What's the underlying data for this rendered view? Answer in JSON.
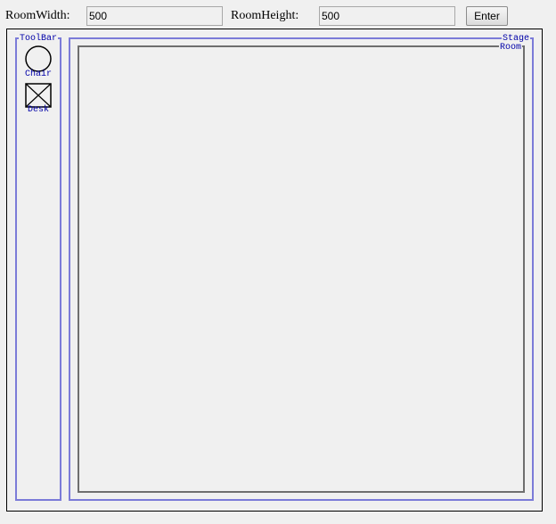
{
  "toolbar": {
    "room_width_label": "RoomWidth:",
    "room_width_value": "500",
    "room_height_label": "RoomHeight:",
    "room_height_value": "500",
    "enter_label": "Enter"
  },
  "tool_panel": {
    "title": "ToolBar",
    "tools": [
      {
        "label": "Chair",
        "icon": "chair-circle-icon"
      },
      {
        "label": "Desk",
        "icon": "desk-box-icon"
      }
    ]
  },
  "stage": {
    "title": "Stage",
    "room_label": "Room"
  },
  "colors": {
    "panel_border": "#7b7bd8",
    "legend_text": "#0000a8",
    "room_border": "#6e6e6e",
    "background": "#f0f0f0"
  }
}
